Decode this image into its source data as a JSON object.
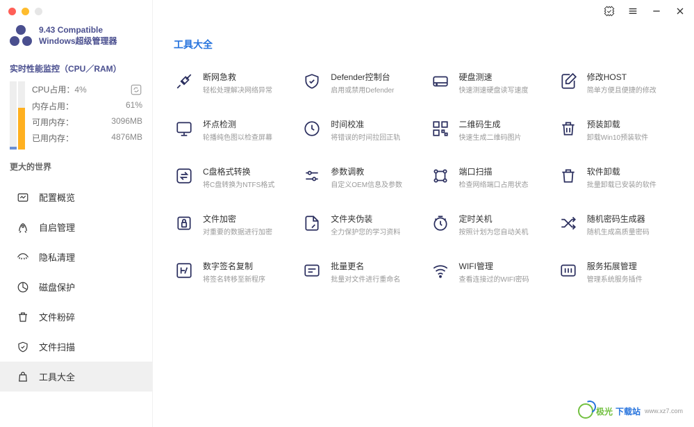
{
  "app": {
    "version_line1": "9.43 Compatible",
    "version_line2": "Windows超级管理器"
  },
  "monitor": {
    "title": "实时性能监控（CPU／RAM）",
    "cpu_label": "CPU占用：",
    "cpu_value": "4%",
    "ram_label": "内存占用：",
    "ram_value": "61%",
    "avail_label": "可用内存：",
    "avail_value": "3096MB",
    "used_label": "已用内存：",
    "used_value": "4876MB"
  },
  "section_label": "更大的世界",
  "nav": [
    {
      "label": "配置概览",
      "icon": "gauge"
    },
    {
      "label": "自启管理",
      "icon": "rocket"
    },
    {
      "label": "隐私清理",
      "icon": "eye"
    },
    {
      "label": "磁盘保护",
      "icon": "pie"
    },
    {
      "label": "文件粉碎",
      "icon": "trash"
    },
    {
      "label": "文件扫描",
      "icon": "shield"
    },
    {
      "label": "工具大全",
      "icon": "bag",
      "active": true
    }
  ],
  "main_title": "工具大全",
  "tools": [
    {
      "title": "断网急救",
      "desc": "轻松处理解决网络异常",
      "icon": "plug"
    },
    {
      "title": "Defender控制台",
      "desc": "启用或禁用Defender",
      "icon": "shield"
    },
    {
      "title": "硬盘测速",
      "desc": "快速测速硬盘读写速度",
      "icon": "hdd"
    },
    {
      "title": "修改HOST",
      "desc": "简单方便且便捷的修改",
      "icon": "edit"
    },
    {
      "title": "坏点检测",
      "desc": "轮播纯色图以检查屏幕",
      "icon": "monitor"
    },
    {
      "title": "时间校准",
      "desc": "将错误的时间拉回正轨",
      "icon": "clock"
    },
    {
      "title": "二维码生成",
      "desc": "快速生成二维码图片",
      "icon": "qr"
    },
    {
      "title": "预装卸载",
      "desc": "卸载Win10预装软件",
      "icon": "trash2"
    },
    {
      "title": "C盘格式转换",
      "desc": "将C盘转换为NTFS格式",
      "icon": "swap"
    },
    {
      "title": "参数调教",
      "desc": "自定义OEM信息及参数",
      "icon": "sliders"
    },
    {
      "title": "端口扫描",
      "desc": "检查网络端口占用状态",
      "icon": "network"
    },
    {
      "title": "软件卸载",
      "desc": "批量卸载已安装的软件",
      "icon": "trash3"
    },
    {
      "title": "文件加密",
      "desc": "对重要的数据进行加密",
      "icon": "lock"
    },
    {
      "title": "文件夹伪装",
      "desc": "全力保护您的学习资料",
      "icon": "folder"
    },
    {
      "title": "定时关机",
      "desc": "按照计划为您自动关机",
      "icon": "timer"
    },
    {
      "title": "随机密码生成器",
      "desc": "随机生成高质量密码",
      "icon": "shuffle"
    },
    {
      "title": "数字签名复制",
      "desc": "将签名转移至新程序",
      "icon": "sign"
    },
    {
      "title": "批量更名",
      "desc": "批量对文件进行重命名",
      "icon": "rename"
    },
    {
      "title": "WIFI管理",
      "desc": "查看连接过的WIFI密码",
      "icon": "wifi"
    },
    {
      "title": "服务拓展管理",
      "desc": "管理系统服务插件",
      "icon": "service"
    }
  ],
  "watermark": {
    "text1": "极光",
    "text2": "下载站",
    "url": "www.xz7.com"
  }
}
